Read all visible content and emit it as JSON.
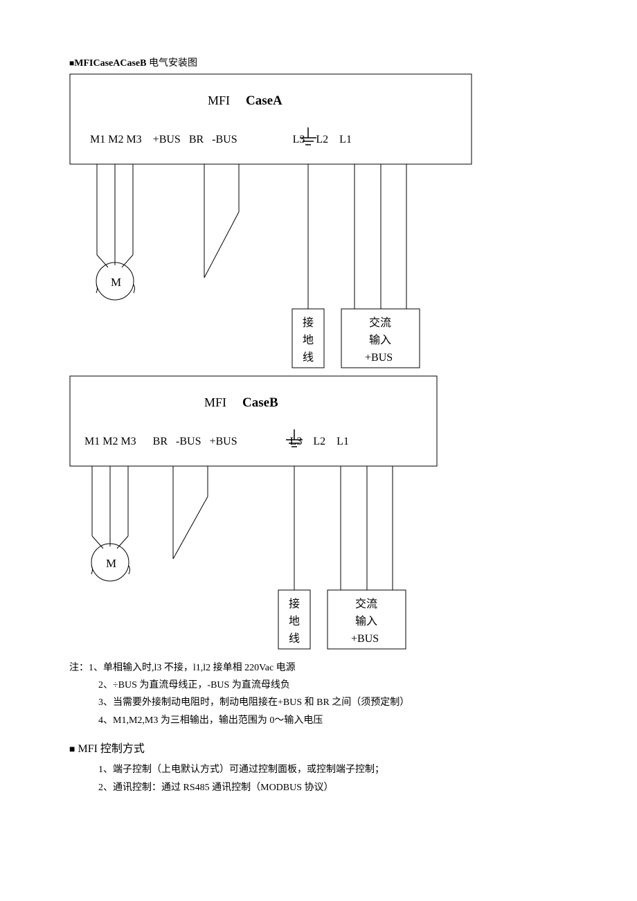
{
  "heading": {
    "bullet": "■",
    "boldPart": "MFICaseACaseB",
    "cnPart": "电气安装图"
  },
  "diagramA": {
    "title_mfi": "MFI",
    "title_case": "CaseA",
    "terminals": "M1 M2 M3    +BUS   BR   -BUS                    L3    L2    L1",
    "motor": "M",
    "groundBox": {
      "l1": "接",
      "l2": "地",
      "l3": "线"
    },
    "acBox": {
      "l1": "交流",
      "l2": "输入",
      "l3": "+BUS"
    }
  },
  "diagramB": {
    "title_mfi": "MFI",
    "title_case": "CaseB",
    "terminals": "M1 M2 M3      BR   -BUS   +BUS                   L3    L2    L1",
    "motor": "M",
    "groundBox": {
      "l1": "接",
      "l2": "地",
      "l3": "线"
    },
    "acBox": {
      "l1": "交流",
      "l2": "输入",
      "l3": "+BUS"
    }
  },
  "notes": {
    "prefix": "注：",
    "n1": "1、单相输入时,l3 不接，l1,l2 接单相 220Vac 电源",
    "n2": "2、÷BUS 为直流母线正，-BUS 为直流母线负",
    "n3": "3、当需要外接制动电阻时，制动电阻接在+BUS 和 BR 之间（须预定制）",
    "n4": "4、M1,M2,M3 为三相输出，输出范围为 0～输入电压"
  },
  "section2": {
    "bullet": "■",
    "title": " MFI 控制方式",
    "c1": "1、端子控制（上电默认方式）可通过控制面板，或控制端子控制；",
    "c2": "2、通讯控制：通过 RS485 通讯控制（MODBUS 协议）"
  }
}
